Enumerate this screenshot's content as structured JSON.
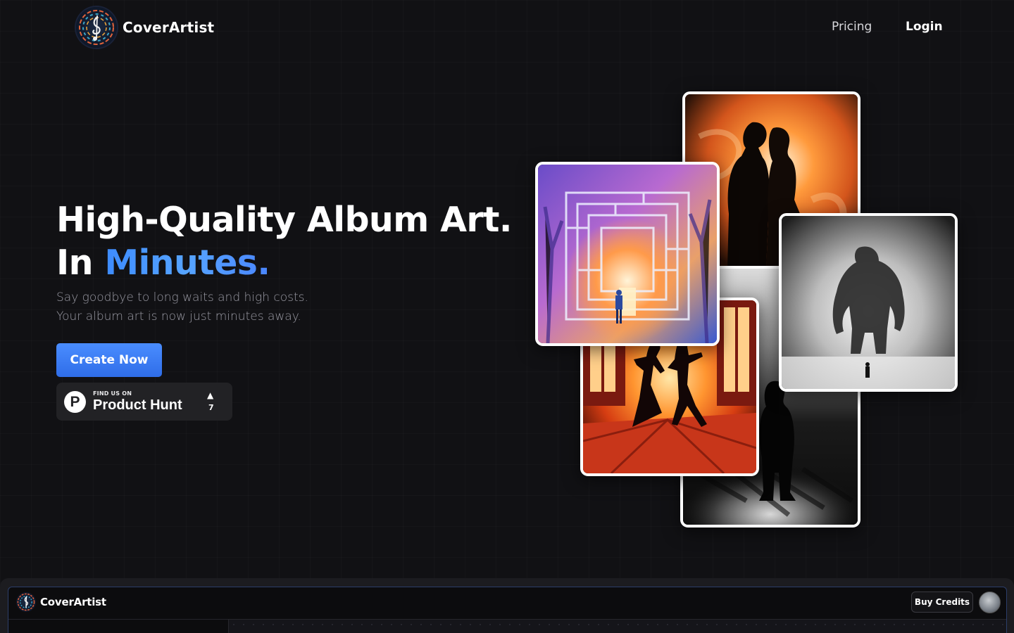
{
  "nav": {
    "brand": "CoverArtist",
    "links": [
      {
        "label": "Pricing"
      },
      {
        "label": "Login"
      }
    ]
  },
  "hero": {
    "title_line1": "High-Quality Album Art.",
    "title_line2_prefix": "In ",
    "title_line2_accent": "Minutes.",
    "subtitle_line1": "Say goodbye to long waits and high costs.",
    "subtitle_line2": "Your album art is now just minutes away.",
    "cta_label": "Create Now",
    "product_hunt": {
      "small_label": "FIND US ON",
      "name": "Product Hunt",
      "logo_letter": "P",
      "arrow": "▲",
      "upvotes": "7"
    }
  },
  "collage": {
    "images": [
      {
        "name": "lovers-silhouette",
        "icon": "silhouette-couple"
      },
      {
        "name": "shadow-figure",
        "icon": "silhouette-man"
      },
      {
        "name": "fire-dancers",
        "icon": "dancing-couple"
      },
      {
        "name": "giant-in-fog",
        "icon": "giant-monster"
      },
      {
        "name": "watercolor-maze",
        "icon": "maze-forest"
      }
    ]
  },
  "app_preview": {
    "brand": "CoverArtist",
    "buy_credits_label": "Buy Credits"
  },
  "colors": {
    "background": "#111114",
    "accent": "#3d8bff",
    "cta": "#3b7ef5",
    "card_border": "#ffffff"
  }
}
